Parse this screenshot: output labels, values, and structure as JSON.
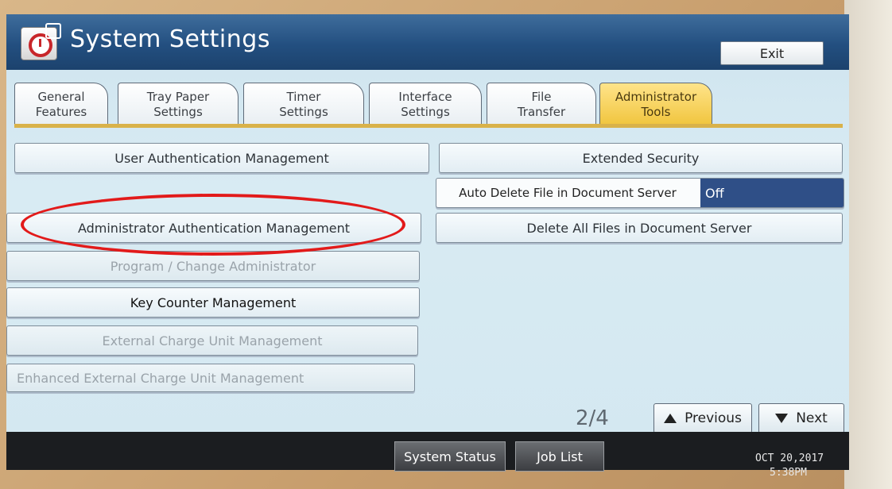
{
  "window": {
    "title": "System Settings",
    "exit_label": "Exit"
  },
  "tabs": [
    {
      "line1": "General",
      "line2": "Features"
    },
    {
      "line1": "Tray Paper",
      "line2": "Settings"
    },
    {
      "line1": "Timer",
      "line2": "Settings"
    },
    {
      "line1": "Interface",
      "line2": "Settings"
    },
    {
      "line1": "File",
      "line2": "Transfer"
    },
    {
      "line1": "Administrator",
      "line2": "Tools",
      "active": true
    }
  ],
  "left_buttons": {
    "user_auth": "User Authentication Management",
    "admin_auth": "Administrator Authentication Management",
    "program_admin": "Program / Change Administrator",
    "key_counter": "Key Counter Management",
    "ext_charge": "External Charge Unit Management",
    "enh_ext_charge": "Enhanced External Charge Unit Management"
  },
  "right_buttons": {
    "extended_security": "Extended Security",
    "auto_delete_label": "Auto Delete File in Document Server",
    "auto_delete_value": "Off",
    "delete_all": "Delete All Files in Document Server"
  },
  "pager": {
    "page": "2∕4",
    "previous": "Previous",
    "next": "Next"
  },
  "status_bar": {
    "system_status": "System Status",
    "job_list": "Job List",
    "date": "OCT  20,2017",
    "time": "5:38PM"
  },
  "colors": {
    "title_bar": "#234f80",
    "active_tab": "#f0c43c",
    "highlight_ring": "#e21a1a",
    "value_box": "#2f4f87"
  }
}
